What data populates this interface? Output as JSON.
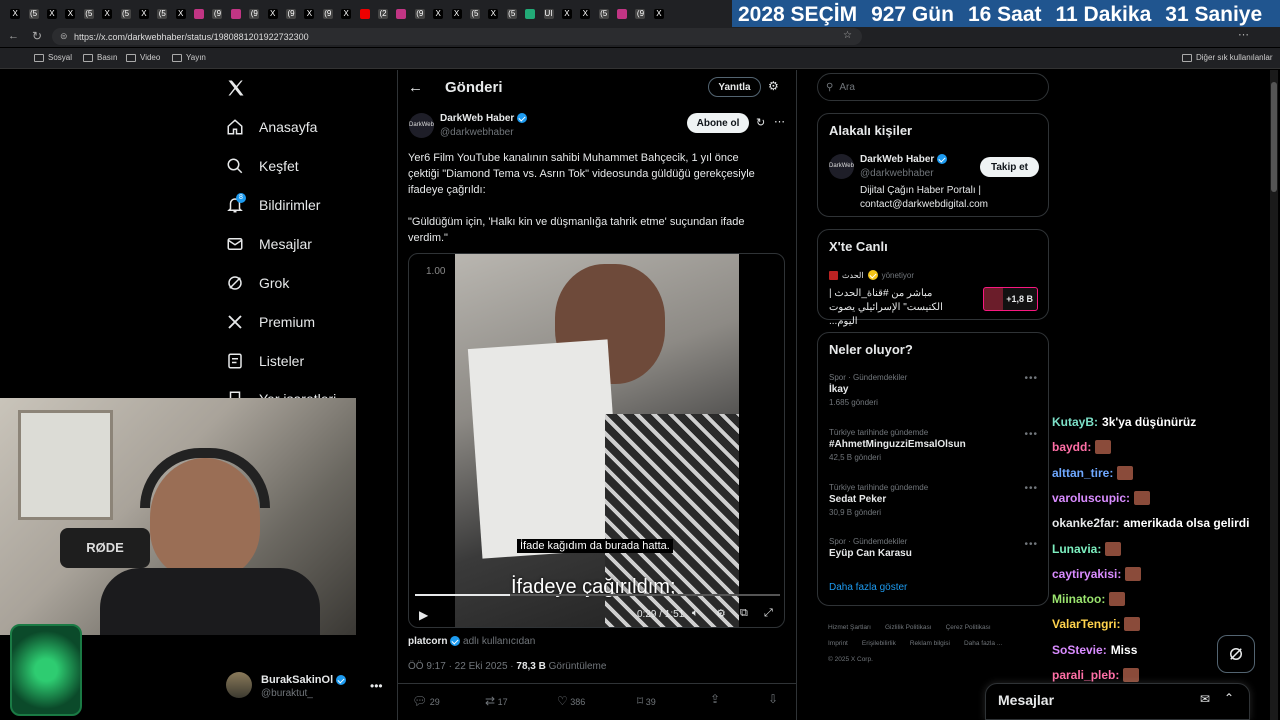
{
  "browser": {
    "url": "https://x.com/darkwebhaber/status/1980881201922732300",
    "tab_icons": [
      "X",
      "(5",
      "X",
      "X",
      "(5",
      "X",
      "(5",
      "X",
      "(5",
      "X",
      "ig",
      "(9",
      "ig",
      "(9",
      "X",
      "(9",
      "X",
      "(9",
      "X",
      "yt",
      "(2",
      "ig",
      "(9",
      "X",
      "X",
      "(5",
      "X",
      "(5",
      "ch",
      "UI",
      "X",
      "X",
      "(5",
      "ig",
      "(9",
      "X"
    ],
    "bookmarks": [
      "Sosyal",
      "Basın",
      "Video",
      "Yayın"
    ],
    "other_bookmarks": "Diğer sık kullanılanlar"
  },
  "countdown": {
    "label": "2028 SEÇİM",
    "days": "927 Gün",
    "hours": "16 Saat",
    "minutes": "11 Dakika",
    "seconds": "31 Saniye"
  },
  "nav": {
    "items": [
      "Anasayfa",
      "Keşfet",
      "Bildirimler",
      "Mesajlar",
      "Grok",
      "Premium",
      "Listeler",
      "Yer işaretleri"
    ],
    "notification_badge": "8",
    "account_name": "BurakSakinOl",
    "account_handle": "@buraktut_"
  },
  "post_header": {
    "title": "Gönderi",
    "reply_button": "Yanıtla"
  },
  "post": {
    "author_name": "DarkWeb Haber",
    "author_handle": "@darkwebhaber",
    "subscribe_button": "Abone ol",
    "avatar_text": "DarkWeb",
    "text_line1": "Yer6 Film YouTube kanalının sahibi Muhammet Bahçecik, 1 yıl önce",
    "text_line2": "çektiği \"Diamond Tema vs. Asrın Tok\" videosunda güldüğü gerekçesiyle",
    "text_line3": "ifadeye çağrıldı:",
    "quote_line1": "\"Güldüğüm için, 'Halkı kin ve düşmanlığa tahrik etme' suçundan ifade",
    "quote_line2": "verdim.\"",
    "video_speed": "1.00",
    "caption_small": "İfade kağıdım da burada hatta.",
    "caption_big": "İfadeye çağırıldım;",
    "video_time": "0:29 / 1:51",
    "source_name": "platcorn",
    "source_suffix": "adlı kullanıcıdan",
    "timestamp": "ÖÖ 9:17 · 22 Eki 2025 · ",
    "views_count": "78,3 B",
    "views_label": " Görüntüleme",
    "replies": "29",
    "reposts": "17",
    "likes": "386",
    "bookmarks": "39"
  },
  "search": {
    "placeholder": "Ara"
  },
  "related": {
    "title": "Alakalı kişiler",
    "name": "DarkWeb Haber",
    "handle": "@darkwebhaber",
    "follow_button": "Takip et",
    "bio_line1": "Dijital Çağın Haber Portalı |",
    "bio_line2": "contact@darkwebdigital.com"
  },
  "live": {
    "title": "X'te Canlı",
    "host": "الحدث",
    "host_suffix": "yönetiyor",
    "line1": "مباشر من #قناة_الحدث |",
    "line2": "الكنيست\" الإسرائيلي يصوت اليوم...",
    "listeners": "+1,8 B"
  },
  "trends": {
    "title": "Neler oluyor?",
    "items": [
      {
        "cat": "Spor · Gündemdekiler",
        "name": "İkay",
        "count": "1.685 gönderi"
      },
      {
        "cat": "Türkiye tarihinde gündemde",
        "name": "#AhmetMinguzziEmsalOlsun",
        "count": "42,5 B gönderi"
      },
      {
        "cat": "Türkiye tarihinde gündemde",
        "name": "Sedat Peker",
        "count": "30,9 B gönderi"
      },
      {
        "cat": "Spor · Gündemdekiler",
        "name": "Eyüp Can Karasu",
        "count": ""
      }
    ],
    "show_more": "Daha fazla göster"
  },
  "footer": {
    "line1": [
      "Hizmet Şartları",
      "Gizlilik Politikası",
      "Çerez Politikası"
    ],
    "line2": [
      "Imprint",
      "Erişilebilirlik",
      "Reklam bilgisi",
      "Daha fazla ..."
    ],
    "copyright": "© 2025 X Corp."
  },
  "messages_bar": {
    "label": "Mesajlar"
  },
  "chat": [
    {
      "user": "KutayB:",
      "msg": "3k'ya düşünürüz",
      "color": "#7de0c8"
    },
    {
      "user": "baydd:",
      "msg": "",
      "color": "#ff6fa6"
    },
    {
      "user": "alttan_tire:",
      "msg": "",
      "color": "#6fa8ff"
    },
    {
      "user": "varoluscupic:",
      "msg": "",
      "color": "#d98cff"
    },
    {
      "user": "okanke2far:",
      "msg": "amerikada olsa gelirdi",
      "color": "#e7e9ea"
    },
    {
      "user": "Lunavia:",
      "msg": "",
      "color": "#7df0c0"
    },
    {
      "user": "caytiryakisi:",
      "msg": "",
      "color": "#d98cff"
    },
    {
      "user": "Miinatoo:",
      "msg": "",
      "color": "#9be56f"
    },
    {
      "user": "ValarTengri:",
      "msg": "",
      "color": "#ffd34d"
    },
    {
      "user": "SoStevie:",
      "msg": "Miss",
      "color": "#d98cff"
    },
    {
      "user": "parali_pleb:",
      "msg": "",
      "color": "#ff6fa6"
    },
    {
      "user": "Cakancakmak:",
      "msg": "",
      "color": "#d98cff"
    }
  ],
  "colors": {
    "accent": "#1d9bf0",
    "countdown_bg": "#20558f",
    "bg": "#000000"
  }
}
